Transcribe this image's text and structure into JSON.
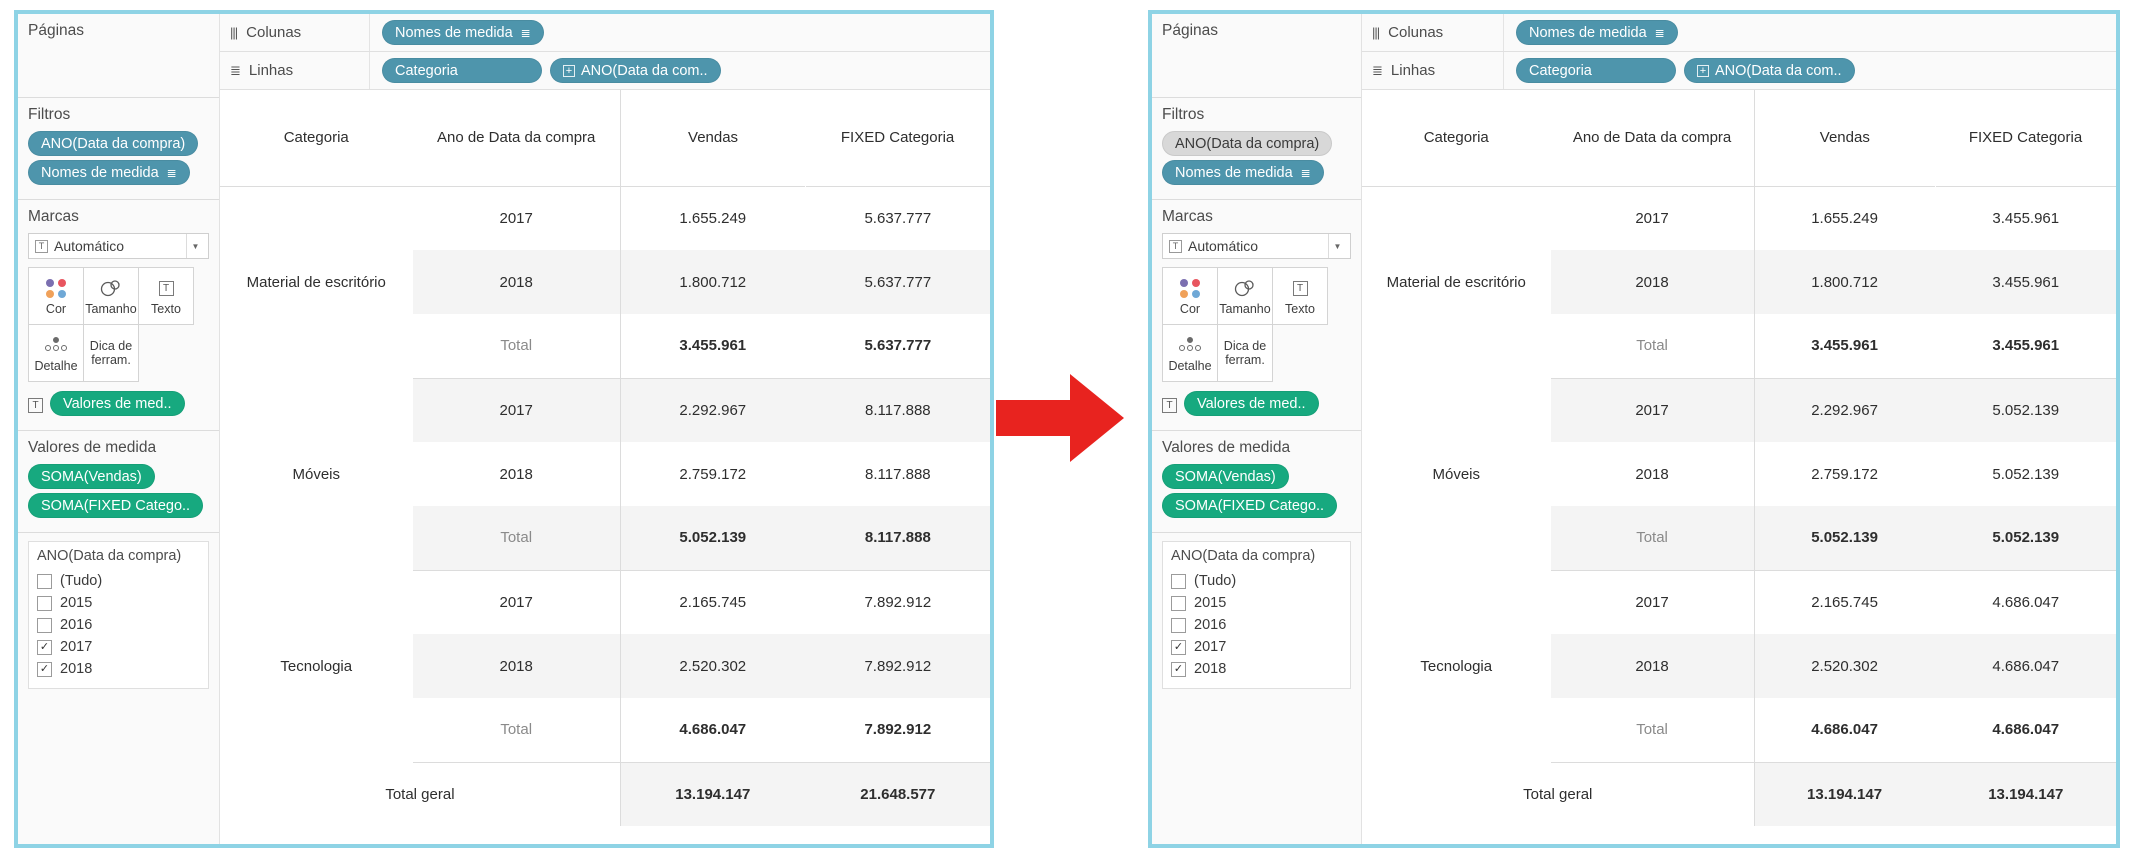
{
  "colors": {
    "pill_blue": "#4e95ac",
    "pill_green": "#17a97f",
    "pill_gray": "#d8d8d8",
    "panel_border": "#8ed3e5",
    "arrow_red": "#e8231f",
    "band_shade": "#f4f4f4"
  },
  "left": {
    "cards": {
      "pages_title": "Páginas",
      "filters_title": "Filtros",
      "filters_pills": [
        {
          "label": "ANO(Data da compra)",
          "style": "blue",
          "icon": ""
        },
        {
          "label": "Nomes de medida",
          "style": "blue",
          "icon": "filter-icon"
        }
      ],
      "marks_title": "Marcas",
      "marks_type": "Automático",
      "marks_buttons": [
        {
          "label": "Cor",
          "icon": "color-dots-icon"
        },
        {
          "label": "Tamanho",
          "icon": "size-circles-icon"
        },
        {
          "label": "Texto",
          "icon": "text-box-icon"
        },
        {
          "label": "Detalhe",
          "icon": "detail-dots-icon"
        },
        {
          "label": "Dica de ferram.",
          "icon": "tooltip-icon"
        }
      ],
      "marks_pill": "Valores de med..",
      "measure_values_title": "Valores de medida",
      "measure_values": [
        "SOMA(Vendas)",
        "SOMA(FIXED Catego.."
      ],
      "filter_card_title": "ANO(Data da compra)",
      "filter_items": [
        {
          "label": "(Tudo)",
          "checked": false
        },
        {
          "label": "2015",
          "checked": false
        },
        {
          "label": "2016",
          "checked": false
        },
        {
          "label": "2017",
          "checked": true
        },
        {
          "label": "2018",
          "checked": true
        }
      ]
    },
    "shelves": {
      "columns_label": "Colunas",
      "columns_pills": [
        {
          "label": "Nomes de medida",
          "style": "blue",
          "icon": "filter-icon"
        }
      ],
      "rows_label": "Linhas",
      "rows_pills": [
        {
          "label": "Categoria",
          "style": "blue",
          "icon": ""
        },
        {
          "label": "ANO(Data da com..",
          "style": "blue",
          "icon": "plus-box-icon"
        }
      ]
    },
    "table": {
      "headers": [
        "Categoria",
        "Ano de Data da compra",
        "Vendas",
        "FIXED Categoria"
      ],
      "groups": [
        {
          "category": "Material de escritório",
          "rows": [
            {
              "year": "2017",
              "vendas": "1.655.249",
              "fixed": "5.637.777",
              "band": false,
              "total": false
            },
            {
              "year": "2018",
              "vendas": "1.800.712",
              "fixed": "5.637.777",
              "band": true,
              "total": false
            },
            {
              "year": "Total",
              "vendas": "3.455.961",
              "fixed": "5.637.777",
              "band": false,
              "total": true
            }
          ]
        },
        {
          "category": "Móveis",
          "rows": [
            {
              "year": "2017",
              "vendas": "2.292.967",
              "fixed": "8.117.888",
              "band": true,
              "total": false
            },
            {
              "year": "2018",
              "vendas": "2.759.172",
              "fixed": "8.117.888",
              "band": false,
              "total": false
            },
            {
              "year": "Total",
              "vendas": "5.052.139",
              "fixed": "8.117.888",
              "band": true,
              "total": true
            }
          ]
        },
        {
          "category": "Tecnologia",
          "rows": [
            {
              "year": "2017",
              "vendas": "2.165.745",
              "fixed": "7.892.912",
              "band": false,
              "total": false
            },
            {
              "year": "2018",
              "vendas": "2.520.302",
              "fixed": "7.892.912",
              "band": true,
              "total": false
            },
            {
              "year": "Total",
              "vendas": "4.686.047",
              "fixed": "7.892.912",
              "band": false,
              "total": true
            }
          ]
        }
      ],
      "grand_total": {
        "label": "Total geral",
        "vendas": "13.194.147",
        "fixed": "21.648.577"
      }
    }
  },
  "right": {
    "cards": {
      "pages_title": "Páginas",
      "filters_title": "Filtros",
      "filters_pills": [
        {
          "label": "ANO(Data da compra)",
          "style": "gray",
          "icon": ""
        },
        {
          "label": "Nomes de medida",
          "style": "blue",
          "icon": "filter-icon"
        }
      ],
      "marks_title": "Marcas",
      "marks_type": "Automático",
      "marks_buttons": [
        {
          "label": "Cor",
          "icon": "color-dots-icon"
        },
        {
          "label": "Tamanho",
          "icon": "size-circles-icon"
        },
        {
          "label": "Texto",
          "icon": "text-box-icon"
        },
        {
          "label": "Detalhe",
          "icon": "detail-dots-icon"
        },
        {
          "label": "Dica de ferram.",
          "icon": "tooltip-icon"
        }
      ],
      "marks_pill": "Valores de med..",
      "measure_values_title": "Valores de medida",
      "measure_values": [
        "SOMA(Vendas)",
        "SOMA(FIXED Catego.."
      ],
      "filter_card_title": "ANO(Data da compra)",
      "filter_items": [
        {
          "label": "(Tudo)",
          "checked": false
        },
        {
          "label": "2015",
          "checked": false
        },
        {
          "label": "2016",
          "checked": false
        },
        {
          "label": "2017",
          "checked": true
        },
        {
          "label": "2018",
          "checked": true
        }
      ]
    },
    "shelves": {
      "columns_label": "Colunas",
      "columns_pills": [
        {
          "label": "Nomes de medida",
          "style": "blue",
          "icon": "filter-icon"
        }
      ],
      "rows_label": "Linhas",
      "rows_pills": [
        {
          "label": "Categoria",
          "style": "blue",
          "icon": ""
        },
        {
          "label": "ANO(Data da com..",
          "style": "blue",
          "icon": "plus-box-icon"
        }
      ]
    },
    "table": {
      "headers": [
        "Categoria",
        "Ano de Data da compra",
        "Vendas",
        "FIXED Categoria"
      ],
      "groups": [
        {
          "category": "Material de escritório",
          "rows": [
            {
              "year": "2017",
              "vendas": "1.655.249",
              "fixed": "3.455.961",
              "band": false,
              "total": false
            },
            {
              "year": "2018",
              "vendas": "1.800.712",
              "fixed": "3.455.961",
              "band": true,
              "total": false
            },
            {
              "year": "Total",
              "vendas": "3.455.961",
              "fixed": "3.455.961",
              "band": false,
              "total": true
            }
          ]
        },
        {
          "category": "Móveis",
          "rows": [
            {
              "year": "2017",
              "vendas": "2.292.967",
              "fixed": "5.052.139",
              "band": true,
              "total": false
            },
            {
              "year": "2018",
              "vendas": "2.759.172",
              "fixed": "5.052.139",
              "band": false,
              "total": false
            },
            {
              "year": "Total",
              "vendas": "5.052.139",
              "fixed": "5.052.139",
              "band": true,
              "total": true
            }
          ]
        },
        {
          "category": "Tecnologia",
          "rows": [
            {
              "year": "2017",
              "vendas": "2.165.745",
              "fixed": "4.686.047",
              "band": false,
              "total": false
            },
            {
              "year": "2018",
              "vendas": "2.520.302",
              "fixed": "4.686.047",
              "band": true,
              "total": false
            },
            {
              "year": "Total",
              "vendas": "4.686.047",
              "fixed": "4.686.047",
              "band": false,
              "total": true
            }
          ]
        }
      ],
      "grand_total": {
        "label": "Total geral",
        "vendas": "13.194.147",
        "fixed": "13.194.147"
      }
    }
  }
}
